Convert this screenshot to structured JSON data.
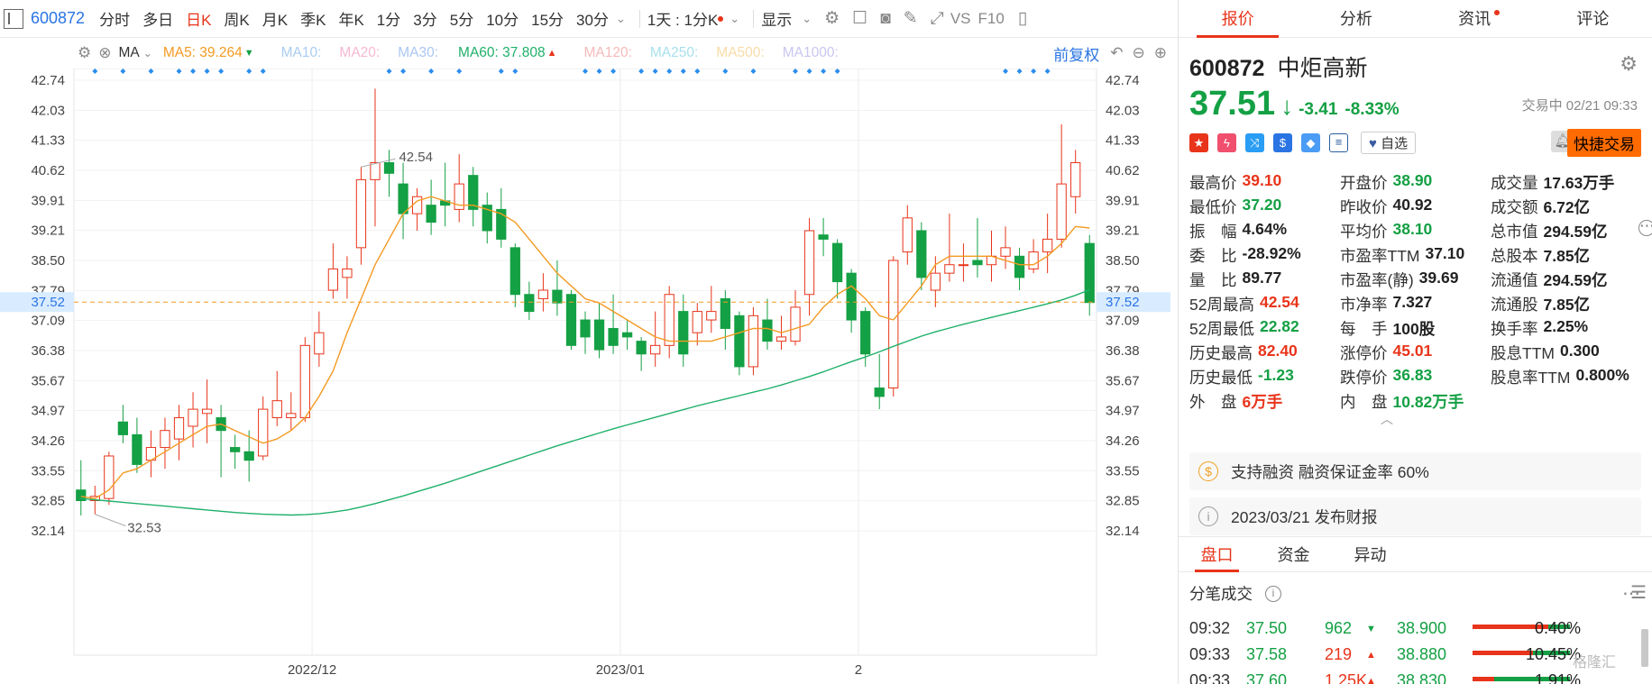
{
  "toolbar": {
    "code": "600872",
    "items": [
      "分时",
      "多日",
      "日K",
      "周K",
      "月K",
      "季K",
      "年K",
      "1分",
      "3分",
      "5分",
      "10分",
      "15分",
      "30分"
    ],
    "active_index": 2,
    "dropdown_1d": "1天 : 1分K",
    "display": "显示",
    "vs": "VS",
    "f10": "F10"
  },
  "ma_bar": {
    "ma_label": "MA",
    "ma5": "MA5: 39.264",
    "ma10": "MA10:",
    "ma20": "MA20:",
    "ma30": "MA30:",
    "ma60": "MA60: 37.808",
    "ma120": "MA120:",
    "ma250": "MA250:",
    "ma500": "MA500:",
    "ma1000": "MA1000:",
    "fq": "前复权",
    "colors": {
      "ma5": "#f39a22",
      "ma10": "#a8cdf0",
      "ma20": "#f5b8d2",
      "ma30": "#a9c7f2",
      "ma60": "#1fb06a",
      "ma120": "#f6b9b9",
      "ma250": "#a8e0ec",
      "ma500": "#f7dca7",
      "ma1000": "#c9c6f0"
    }
  },
  "chart_data": {
    "type": "candlestick",
    "y_ticks": [
      "42.74",
      "42.03",
      "41.33",
      "40.62",
      "39.91",
      "39.21",
      "38.50",
      "37.79",
      "37.09",
      "36.38",
      "35.67",
      "34.97",
      "34.26",
      "33.55",
      "32.85",
      "32.14"
    ],
    "ylim": [
      32.14,
      42.74
    ],
    "x_labels": [
      {
        "label": "2022/12",
        "index": 17
      },
      {
        "label": "2023/01",
        "index": 39
      },
      {
        "label": "2",
        "index": 56
      }
    ],
    "current_price": "37.52",
    "high_label": {
      "text": "42.54",
      "index": 20
    },
    "low_label": {
      "text": "32.53",
      "index": 1
    },
    "candles": [
      [
        33.1,
        32.85,
        33.8,
        32.5
      ],
      [
        32.85,
        32.95,
        33.2,
        32.53
      ],
      [
        32.9,
        33.9,
        34.0,
        32.75
      ],
      [
        34.7,
        34.4,
        35.1,
        34.2
      ],
      [
        34.4,
        33.7,
        34.8,
        33.5
      ],
      [
        33.8,
        34.1,
        34.5,
        33.4
      ],
      [
        34.1,
        34.5,
        34.8,
        33.6
      ],
      [
        34.3,
        34.8,
        35.1,
        33.8
      ],
      [
        34.6,
        35.0,
        35.4,
        34.1
      ],
      [
        34.9,
        35.0,
        35.7,
        34.2
      ],
      [
        34.8,
        34.5,
        35.1,
        33.4
      ],
      [
        34.1,
        34.0,
        34.4,
        33.6
      ],
      [
        34.0,
        33.8,
        34.5,
        33.3
      ],
      [
        33.9,
        35.0,
        35.3,
        33.8
      ],
      [
        34.8,
        35.2,
        35.9,
        34.6
      ],
      [
        34.8,
        34.9,
        35.4,
        34.5
      ],
      [
        34.8,
        36.5,
        36.7,
        34.7
      ],
      [
        36.3,
        36.8,
        37.3,
        36.0
      ],
      [
        37.8,
        38.3,
        38.9,
        37.6
      ],
      [
        38.1,
        38.3,
        38.6,
        37.6
      ],
      [
        38.8,
        40.4,
        40.7,
        38.4
      ],
      [
        40.4,
        40.8,
        42.54,
        39.3
      ],
      [
        40.8,
        40.55,
        41.1,
        40.0
      ],
      [
        40.3,
        39.6,
        40.8,
        39.0
      ],
      [
        39.6,
        40.0,
        40.2,
        39.2
      ],
      [
        39.8,
        39.4,
        40.4,
        39.1
      ],
      [
        39.9,
        39.8,
        40.8,
        39.3
      ],
      [
        39.7,
        40.3,
        41.0,
        39.4
      ],
      [
        40.5,
        39.7,
        40.7,
        39.3
      ],
      [
        39.8,
        39.2,
        40.1,
        38.9
      ],
      [
        39.7,
        39.0,
        40.2,
        38.8
      ],
      [
        38.8,
        37.7,
        38.9,
        37.4
      ],
      [
        37.7,
        37.3,
        38.0,
        37.1
      ],
      [
        37.6,
        37.8,
        38.2,
        37.3
      ],
      [
        37.8,
        37.5,
        38.5,
        37.2
      ],
      [
        37.7,
        36.5,
        37.8,
        36.4
      ],
      [
        37.1,
        36.7,
        37.3,
        36.3
      ],
      [
        37.1,
        36.4,
        37.5,
        36.2
      ],
      [
        36.9,
        36.5,
        37.7,
        36.3
      ],
      [
        36.8,
        36.7,
        37.1,
        36.4
      ],
      [
        36.6,
        36.3,
        36.7,
        35.9
      ],
      [
        36.3,
        36.5,
        37.3,
        36.0
      ],
      [
        36.5,
        37.7,
        37.9,
        36.2
      ],
      [
        37.3,
        36.3,
        37.7,
        36.0
      ],
      [
        36.8,
        37.3,
        37.5,
        36.5
      ],
      [
        37.1,
        37.3,
        37.9,
        36.8
      ],
      [
        37.6,
        36.9,
        37.8,
        36.4
      ],
      [
        37.2,
        36.0,
        37.3,
        35.8
      ],
      [
        36.0,
        37.2,
        37.4,
        35.8
      ],
      [
        37.1,
        36.6,
        37.6,
        36.4
      ],
      [
        36.6,
        36.7,
        37.2,
        36.4
      ],
      [
        36.6,
        37.4,
        37.8,
        36.5
      ],
      [
        37.7,
        39.2,
        39.5,
        37.2
      ],
      [
        39.1,
        39.0,
        39.5,
        38.6
      ],
      [
        38.9,
        38.0,
        39.0,
        37.6
      ],
      [
        38.2,
        37.1,
        38.3,
        36.8
      ],
      [
        37.3,
        36.3,
        37.4,
        36.0
      ],
      [
        35.5,
        35.3,
        36.3,
        35.0
      ],
      [
        35.5,
        38.5,
        38.6,
        35.3
      ],
      [
        38.7,
        39.5,
        39.8,
        38.4
      ],
      [
        39.2,
        38.1,
        39.4,
        37.8
      ],
      [
        37.8,
        38.2,
        38.6,
        37.4
      ],
      [
        38.2,
        38.4,
        39.6,
        38.0
      ],
      [
        38.4,
        38.4,
        38.9,
        38.0
      ],
      [
        38.5,
        38.4,
        39.5,
        38.1
      ],
      [
        38.4,
        38.6,
        39.2,
        38.0
      ],
      [
        38.6,
        38.8,
        39.3,
        38.3
      ],
      [
        38.6,
        38.1,
        38.8,
        37.8
      ],
      [
        38.3,
        38.7,
        39.0,
        38.2
      ],
      [
        38.7,
        39.0,
        39.6,
        38.2
      ],
      [
        39.0,
        40.3,
        41.7,
        38.8
      ],
      [
        40.0,
        40.8,
        41.1,
        39.6
      ],
      [
        38.9,
        37.51,
        39.1,
        37.2
      ]
    ],
    "ma5": [
      32.95,
      32.9,
      33.1,
      33.5,
      33.6,
      33.8,
      34.0,
      34.2,
      34.4,
      34.6,
      34.65,
      34.5,
      34.35,
      34.2,
      34.3,
      34.5,
      34.8,
      35.3,
      35.9,
      36.8,
      37.6,
      38.4,
      39.0,
      39.6,
      39.9,
      40.0,
      39.9,
      39.8,
      39.8,
      39.7,
      39.6,
      39.4,
      39.0,
      38.6,
      38.2,
      37.9,
      37.6,
      37.5,
      37.3,
      37.1,
      36.9,
      36.7,
      36.6,
      36.6,
      36.6,
      36.6,
      36.7,
      36.8,
      36.9,
      36.9,
      36.8,
      36.9,
      37.0,
      37.4,
      37.7,
      37.9,
      37.6,
      37.2,
      37.1,
      37.5,
      37.9,
      38.4,
      38.6,
      38.6,
      38.6,
      38.6,
      38.5,
      38.4,
      38.4,
      38.6,
      38.9,
      39.3,
      39.264
    ],
    "ma60": [
      32.9,
      32.87,
      32.84,
      32.81,
      32.78,
      32.75,
      32.72,
      32.69,
      32.66,
      32.63,
      32.6,
      32.57,
      32.55,
      32.53,
      32.52,
      32.51,
      32.52,
      32.54,
      32.58,
      32.63,
      32.7,
      32.78,
      32.87,
      32.96,
      33.06,
      33.16,
      33.26,
      33.37,
      33.48,
      33.59,
      33.7,
      33.81,
      33.92,
      34.03,
      34.14,
      34.24,
      34.34,
      34.44,
      34.54,
      34.63,
      34.72,
      34.81,
      34.9,
      34.99,
      35.08,
      35.16,
      35.24,
      35.32,
      35.4,
      35.48,
      35.57,
      35.67,
      35.77,
      35.88,
      36.0,
      36.12,
      36.23,
      36.35,
      36.48,
      36.6,
      36.72,
      36.82,
      36.91,
      37.0,
      37.08,
      37.16,
      37.24,
      37.32,
      37.4,
      37.48,
      37.57,
      37.68,
      37.808
    ]
  },
  "tabs": [
    "报价",
    "分析",
    "资讯",
    "评论"
  ],
  "quote": {
    "code": "600872",
    "name": "中炬高新",
    "price": "37.51",
    "arrow": "↓",
    "change": "-3.41",
    "pct": "-8.33%",
    "status": "交易中 02/21 09:33",
    "watch": "自选",
    "trade_btn": "快捷交易",
    "rows": [
      [
        {
          "l": "最高价",
          "v": "39.10",
          "c": "red"
        },
        {
          "l": "开盘价",
          "v": "38.90",
          "c": "grn"
        },
        {
          "l": "成交量",
          "v": "17.63万手",
          "c": "blk"
        }
      ],
      [
        {
          "l": "最低价",
          "v": "37.20",
          "c": "grn"
        },
        {
          "l": "昨收价",
          "v": "40.92",
          "c": "blk"
        },
        {
          "l": "成交额",
          "v": "6.72亿",
          "c": "blk"
        }
      ],
      [
        {
          "l": "振　幅",
          "v": "4.64%",
          "c": "blk"
        },
        {
          "l": "平均价",
          "v": "38.10",
          "c": "grn"
        },
        {
          "l": "总市值",
          "v": "294.59亿",
          "c": "blk"
        }
      ],
      [
        {
          "l": "委　比",
          "v": "-28.92%",
          "c": "blk"
        },
        {
          "l": "市盈率TTM",
          "v": "37.10",
          "c": "blk"
        },
        {
          "l": "总股本",
          "v": "7.85亿",
          "c": "blk"
        }
      ],
      [
        {
          "l": "量　比",
          "v": "89.77",
          "c": "blk"
        },
        {
          "l": "市盈率(静)",
          "v": "39.69",
          "c": "blk"
        },
        {
          "l": "流通值",
          "v": "294.59亿",
          "c": "blk"
        }
      ],
      [
        {
          "l": "52周最高",
          "v": "42.54",
          "c": "red"
        },
        {
          "l": "市净率",
          "v": "7.327",
          "c": "blk"
        },
        {
          "l": "流通股",
          "v": "7.85亿",
          "c": "blk"
        }
      ],
      [
        {
          "l": "52周最低",
          "v": "22.82",
          "c": "grn"
        },
        {
          "l": "每　手",
          "v": "100股",
          "c": "blk"
        },
        {
          "l": "换手率",
          "v": "2.25%",
          "c": "blk"
        }
      ],
      [
        {
          "l": "历史最高",
          "v": "82.40",
          "c": "red"
        },
        {
          "l": "涨停价",
          "v": "45.01",
          "c": "red"
        },
        {
          "l": "股息TTM",
          "v": "0.300",
          "c": "blk"
        }
      ],
      [
        {
          "l": "历史最低",
          "v": "-1.23",
          "c": "grn"
        },
        {
          "l": "跌停价",
          "v": "36.83",
          "c": "grn"
        },
        {
          "l": "股息率TTM",
          "v": "0.800%",
          "c": "blk"
        }
      ],
      [
        {
          "l": "外　盘",
          "v": "6万手",
          "c": "red"
        },
        {
          "l": "内　盘",
          "v": "10.82万手",
          "c": "grn"
        },
        {
          "l": "",
          "v": "",
          "c": "blk"
        }
      ]
    ]
  },
  "info": {
    "margin": "支持融资 融资保证金率 60%",
    "report": "2023/03/21  发布财报"
  },
  "bottom_tabs": [
    "盘口",
    "资金",
    "异动"
  ],
  "ticks_title": "分笔成交",
  "ticks": [
    {
      "time": "09:32",
      "price": "37.50",
      "vol": "962",
      "dir": "down",
      "ref": "38.900",
      "pct": "0.40%",
      "fill": 0.78
    },
    {
      "time": "09:33",
      "price": "37.58",
      "vol": "219",
      "dir": "up",
      "ref": "38.880",
      "pct": "10.45%",
      "fill": 0.62
    },
    {
      "time": "09:33",
      "price": "37.60",
      "vol": "1.25K",
      "dir": "up",
      "ref": "38.830",
      "pct": "1.91%",
      "fill": 0.22
    }
  ],
  "watermark": "格隆汇"
}
